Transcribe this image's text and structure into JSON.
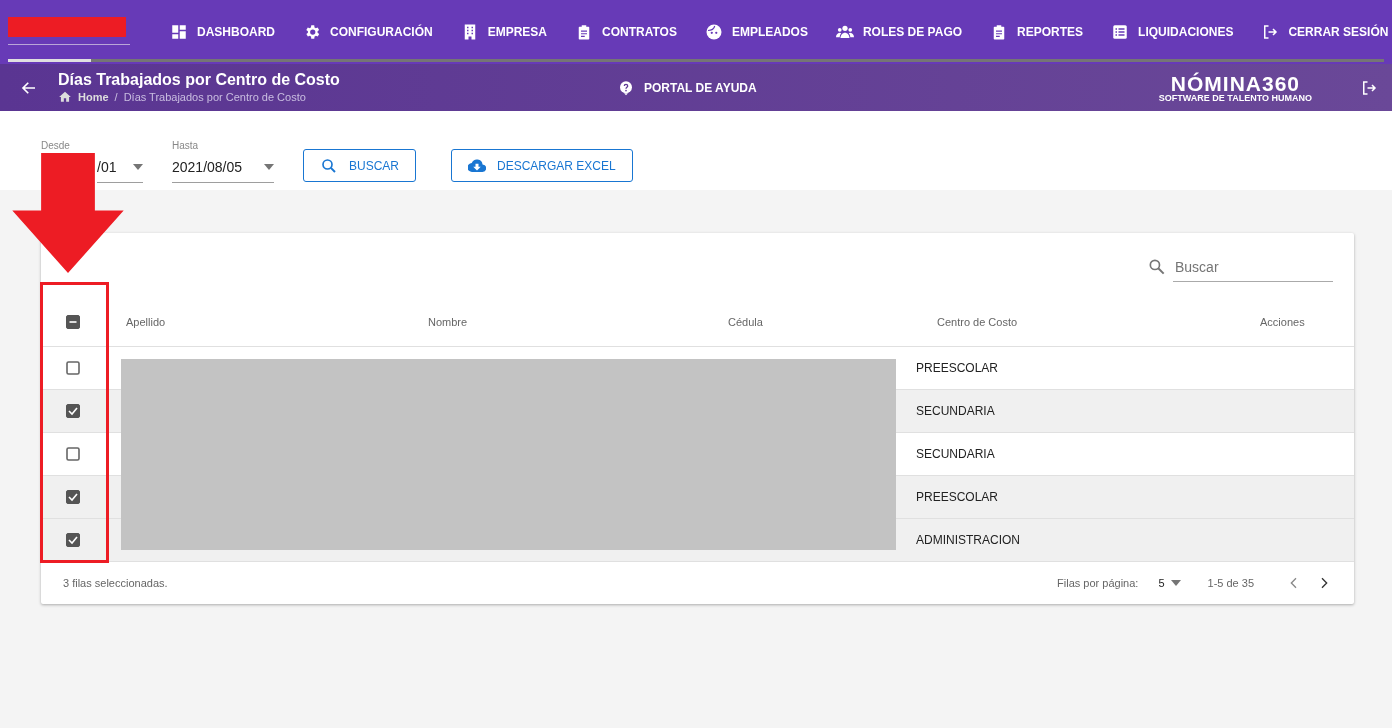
{
  "nav": [
    {
      "label": "DASHBOARD"
    },
    {
      "label": "CONFIGURACIÓN"
    },
    {
      "label": "EMPRESA"
    },
    {
      "label": "CONTRATOS"
    },
    {
      "label": "EMPLEADOS"
    },
    {
      "label": "ROLES DE PAGO"
    },
    {
      "label": "REPORTES"
    },
    {
      "label": "LIQUIDACIONES"
    },
    {
      "label": "CERRAR SESIÓN"
    }
  ],
  "progress": {
    "level": 0.06
  },
  "page_title": "Días Trabajados por Centro de Costo",
  "breadcrumb": [
    "Home",
    "Días Trabajados por Centro de Costo"
  ],
  "breadcrumb_separator": "/",
  "help_link": "PORTAL DE AYUDA",
  "logo": {
    "name": "NÓMINA360",
    "tagline": "SOFTWARE DE TALENTO HUMANO"
  },
  "filters": [
    {
      "label": "Desde",
      "value": "/01"
    },
    {
      "label": "Hasta",
      "value": "2021/08/05"
    }
  ],
  "buttons": [
    {
      "label": "BUSCAR"
    },
    {
      "label": "DESCARGAR EXCEL"
    }
  ],
  "search": {
    "placeholder": "Buscar"
  },
  "table": {
    "header_checkbox": {
      "indeterminate": true
    },
    "columns": [
      "Apellido",
      "Nombre",
      "Cédula",
      "Centro de Costo",
      "Acciones"
    ],
    "rows": [
      {
        "selected": false,
        "centro": "PREESCOLAR"
      },
      {
        "selected": true,
        "centro": "SECUNDARIA"
      },
      {
        "selected": false,
        "centro": "SECUNDARIA"
      },
      {
        "selected": true,
        "centro": "PREESCOLAR"
      },
      {
        "selected": true,
        "centro": "ADMINISTRACION"
      }
    ]
  },
  "footer": {
    "selection": "3 filas seleccionadas.",
    "rows_per_page_label": "Filas por página:",
    "rows_per_page": "5",
    "range": "1-5 de 35"
  }
}
